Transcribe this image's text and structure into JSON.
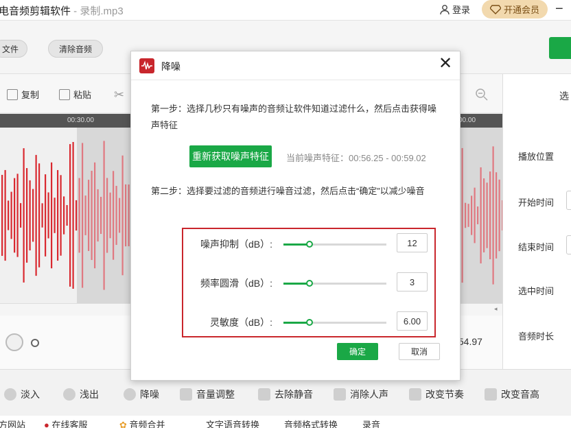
{
  "window": {
    "title": "电音频剪辑软件",
    "file": "录制.mp3",
    "login_label": "登录",
    "vip_label": "开通会员"
  },
  "toolbar": {
    "open_file_label": "文件",
    "clear_audio_label": "清除音频"
  },
  "edit_tools": {
    "copy_label": "复制",
    "paste_label": "粘贴"
  },
  "timeline": {
    "tick_1": "00:30.00",
    "tick_2": "00.00"
  },
  "player": {
    "time_right": ":54.97"
  },
  "right_panel": {
    "header": "选",
    "play_position": "播放位置",
    "start_time": "开始时间",
    "end_time": "结束时间",
    "selected_time": "选中时间",
    "audio_duration": "音频时长"
  },
  "effects": {
    "fade_in": "淡入",
    "fade_out": "浅出",
    "denoise": "降噪",
    "volume": "音量调整",
    "remove_silence": "去除静音",
    "remove_vocals": "消除人声",
    "change_tempo": "改变节奏",
    "change_pitch": "改变音高"
  },
  "bottom_bar": {
    "website": "方网站",
    "support": "在线客服",
    "merge": "音频合并",
    "tts": "文字语音转换",
    "format": "音频格式转换",
    "record": "录音"
  },
  "dialog": {
    "title": "降噪",
    "step1": "第一步：选择几秒只有噪声的音频让软件知道过滤什么，然后点击获得噪声特征",
    "refetch_button": "重新获取噪声特征",
    "current_feature": "当前噪声特征：00:56.25 - 00:59.02",
    "step2": "第二步：选择要过滤的音频进行噪音过滤，然后点击“确定”以减少噪音",
    "params": [
      {
        "label": "噪声抑制（dB）:",
        "value": "12",
        "level": 0.25
      },
      {
        "label": "频率圆滑（dB）:",
        "value": "3",
        "level": 0.25
      },
      {
        "label": "灵敏度（dB）:",
        "value": "6.00",
        "level": 0.25
      }
    ],
    "ok_label": "确定",
    "cancel_label": "取消"
  },
  "colors": {
    "accent": "#1aa846",
    "wave": "#d9282f",
    "highlight_box": "#c9262c"
  }
}
